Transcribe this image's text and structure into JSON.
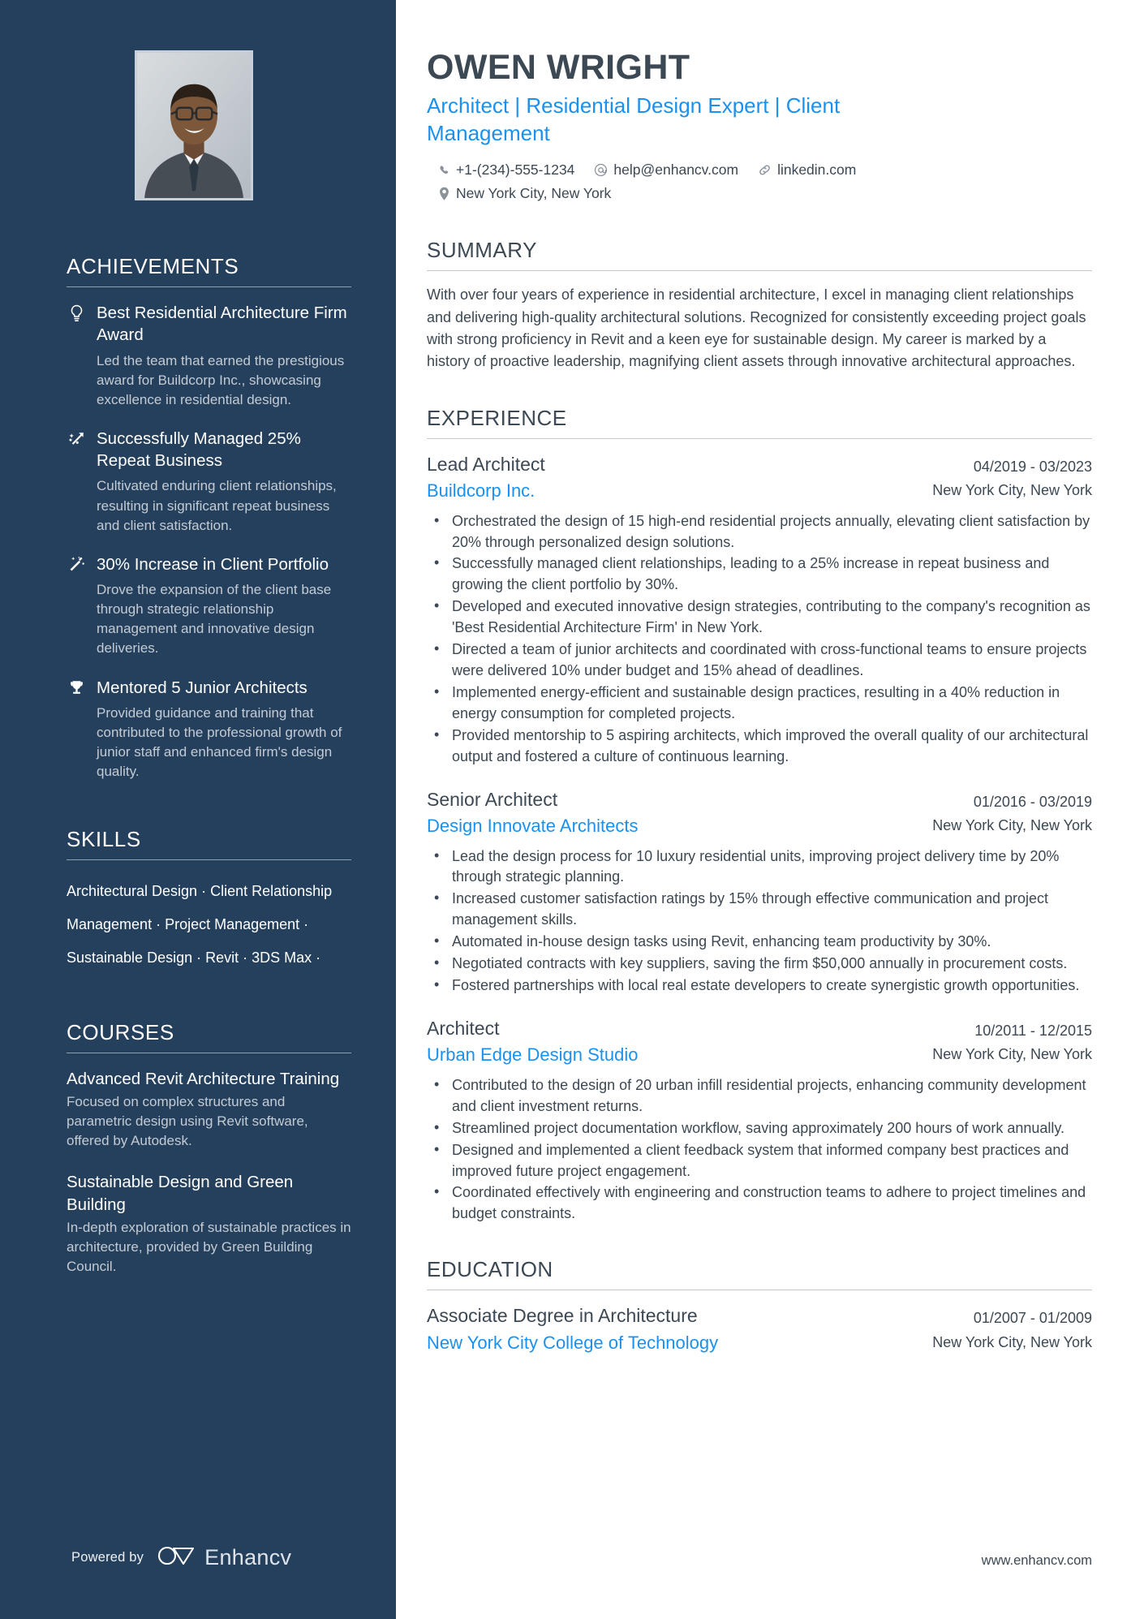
{
  "profile": {
    "name": "OWEN WRIGHT",
    "headline": "Architect | Residential Design Expert | Client Management",
    "phone": "+1-(234)-555-1234",
    "email": "help@enhancv.com",
    "linkedin": "linkedin.com",
    "location": "New York City, New York",
    "accent_color": "#1a91f0",
    "sidebar_color": "#25405c"
  },
  "sidebar": {
    "achievements_heading": "ACHIEVEMENTS",
    "achievements": [
      {
        "icon": "lightbulb-icon",
        "title": "Best Residential Architecture Firm Award",
        "description": "Led the team that earned the prestigious award for Buildcorp Inc., showcasing excellence in residential design."
      },
      {
        "icon": "trending-up-icon",
        "title": "Successfully Managed 25% Repeat Business",
        "description": "Cultivated enduring client relationships, resulting in significant repeat business and client satisfaction."
      },
      {
        "icon": "magic-wand-icon",
        "title": "30% Increase in Client Portfolio",
        "description": "Drove the expansion of the client base through strategic relationship management and innovative design deliveries."
      },
      {
        "icon": "trophy-icon",
        "title": "Mentored 5 Junior Architects",
        "description": "Provided guidance and training that contributed to the professional growth of junior staff and enhanced firm's design quality."
      }
    ],
    "skills_heading": "SKILLS",
    "skills": [
      "Architectural Design",
      "Client Relationship Management",
      "Project Management",
      "Sustainable Design",
      "Revit",
      "3DS Max"
    ],
    "skill_separator": "·",
    "courses_heading": "COURSES",
    "courses": [
      {
        "title": "Advanced Revit Architecture Training",
        "description": "Focused on complex structures and parametric design using Revit software, offered by Autodesk."
      },
      {
        "title": "Sustainable Design and Green Building",
        "description": "In-depth exploration of sustainable practices in architecture, provided by Green Building Council."
      }
    ],
    "powered_by_label": "Powered by",
    "brand_name": "Enhancv"
  },
  "main": {
    "summary_heading": "SUMMARY",
    "summary_text": "With over four years of experience in residential architecture, I excel in managing client relationships and delivering high-quality architectural solutions. Recognized for consistently exceeding project goals with strong proficiency in Revit and a keen eye for sustainable design. My career is marked by a history of proactive leadership, magnifying client assets through innovative architectural approaches.",
    "experience_heading": "EXPERIENCE",
    "experience": [
      {
        "title": "Lead Architect",
        "organization": "Buildcorp Inc.",
        "dates": "04/2019 - 03/2023",
        "location": "New York City, New York",
        "bullets": [
          "Orchestrated the design of 15 high-end residential projects annually, elevating client satisfaction by 20% through personalized design solutions.",
          "Successfully managed client relationships, leading to a 25% increase in repeat business and growing the client portfolio by 30%.",
          "Developed and executed innovative design strategies, contributing to the company's recognition as 'Best Residential Architecture Firm' in New York.",
          "Directed a team of junior architects and coordinated with cross-functional teams to ensure projects were delivered 10% under budget and 15% ahead of deadlines.",
          "Implemented energy-efficient and sustainable design practices, resulting in a 40% reduction in energy consumption for completed projects.",
          "Provided mentorship to 5 aspiring architects, which improved the overall quality of our architectural output and fostered a culture of continuous learning."
        ]
      },
      {
        "title": "Senior Architect",
        "organization": "Design Innovate Architects",
        "dates": "01/2016 - 03/2019",
        "location": "New York City, New York",
        "bullets": [
          "Lead the design process for 10 luxury residential units, improving project delivery time by 20% through strategic planning.",
          "Increased customer satisfaction ratings by 15% through effective communication and project management skills.",
          "Automated in-house design tasks using Revit, enhancing team productivity by 30%.",
          "Negotiated contracts with key suppliers, saving the firm $50,000 annually in procurement costs.",
          "Fostered partnerships with local real estate developers to create synergistic growth opportunities."
        ]
      },
      {
        "title": "Architect",
        "organization": "Urban Edge Design Studio",
        "dates": "10/2011 - 12/2015",
        "location": "New York City, New York",
        "bullets": [
          "Contributed to the design of 20 urban infill residential projects, enhancing community development and client investment returns.",
          "Streamlined project documentation workflow, saving approximately 200 hours of work annually.",
          "Designed and implemented a client feedback system that informed company best practices and improved future project engagement.",
          "Coordinated effectively with engineering and construction teams to adhere to project timelines and budget constraints."
        ]
      }
    ],
    "education_heading": "EDUCATION",
    "education": [
      {
        "title": "Associate Degree in Architecture",
        "organization": "New York City College of Technology",
        "dates": "01/2007 - 01/2009",
        "location": "New York City, New York"
      }
    ],
    "site_url": "www.enhancv.com"
  }
}
